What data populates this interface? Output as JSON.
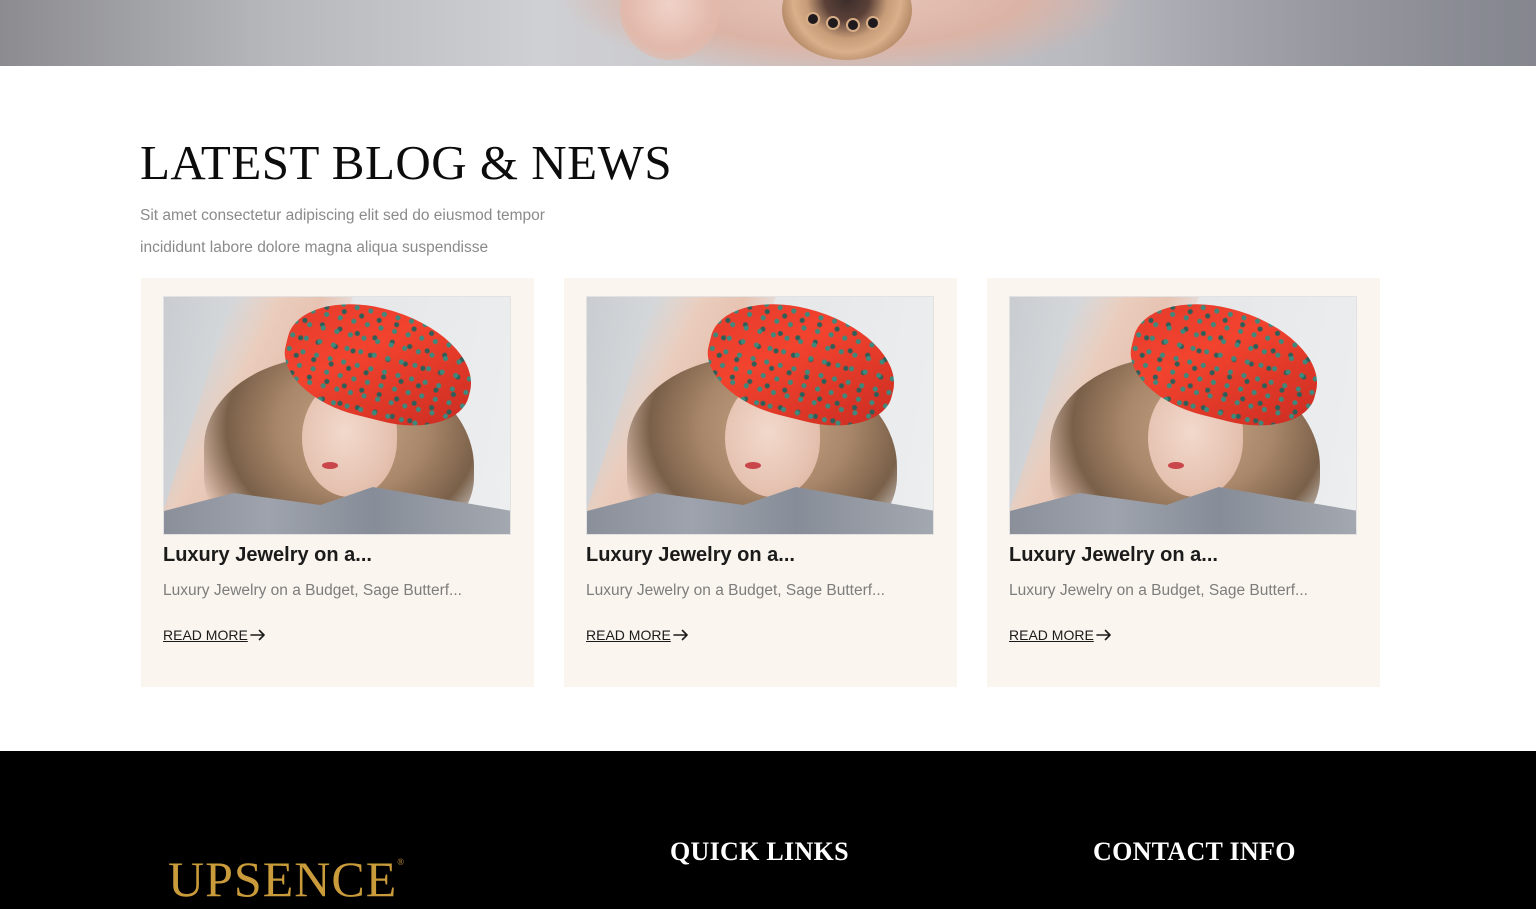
{
  "hero": {
    "image": "hand-with-ring-photo"
  },
  "blog": {
    "heading": "LATEST BLOG & NEWS",
    "intro": "Sit amet consectetur adipiscing elit sed do eiusmod tempor incididunt labore dolore magna aliqua suspendisse",
    "cards": [
      {
        "image": "woman-red-headband-photo",
        "title": "Luxury Jewelry on a...",
        "excerpt": "Luxury Jewelry on a Budget, Sage Butterf...",
        "link": "READ MORE",
        "link_icon": "arrow-right-icon"
      },
      {
        "image": "woman-red-headband-photo",
        "title": "Luxury Jewelry on a...",
        "excerpt": "Luxury Jewelry on a Budget, Sage Butterf...",
        "link": "READ MORE",
        "link_icon": "arrow-right-icon"
      },
      {
        "image": "woman-red-headband-photo",
        "title": "Luxury Jewelry on a...",
        "excerpt": "Luxury Jewelry on a Budget, Sage Butterf...",
        "link": "READ MORE",
        "link_icon": "arrow-right-icon"
      }
    ]
  },
  "footer": {
    "logo": "UPSENCE",
    "logo_mark": "®",
    "quick_links_heading": "QUICK LINKS",
    "contact_heading": "CONTACT INFO"
  },
  "colors": {
    "card_bg": "#faf5ee",
    "footer_bg": "#000000",
    "logo_gold": "#c99b3b",
    "heading_text": "#0c0c0c",
    "muted_text": "#8a8a8a"
  }
}
